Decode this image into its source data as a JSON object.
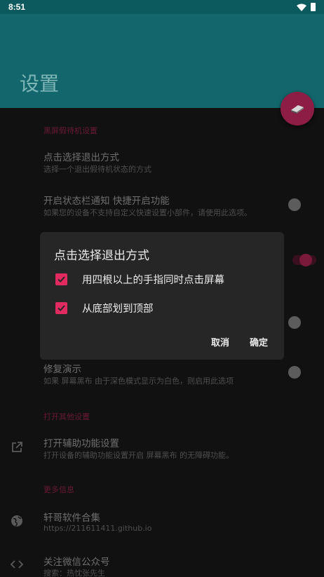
{
  "status": {
    "time": "8:51"
  },
  "appbar": {
    "title": "设置"
  },
  "sections": {
    "screen": "黑屏假待机设置",
    "other": "打开其他设置",
    "more": "更多信息"
  },
  "items": {
    "exit": {
      "title": "点击选择退出方式",
      "sub": "选择一个退出假待机状态的方式"
    },
    "notify": {
      "title": "开启状态栏通知 快捷开启功能",
      "sub": "如果您的设备不支持自定义快速设置小部件，请使用此选项。"
    },
    "fix": {
      "title": "修复演示",
      "sub": "如果 屏幕黑布 由于深色模式显示为白色，则启用此选项"
    },
    "access": {
      "title": "打开辅助功能设置",
      "sub": "打开设备的辅助功能设置开启 屏幕黑布 的无障碍功能。"
    },
    "apps": {
      "title": "轩哥软件合集",
      "sub": "https://211611411.github.io"
    },
    "wechat": {
      "title": "关注微信公众号",
      "sub": "搜索：热忱张先生"
    }
  },
  "switches": {
    "notify": false,
    "hidden1": true,
    "hidden2": false,
    "fix": false
  },
  "dialog": {
    "title": "点击选择退出方式",
    "options": [
      {
        "label": "用四根以上的手指同时点击屏幕",
        "checked": true
      },
      {
        "label": "从底部划到顶部",
        "checked": true
      }
    ],
    "cancel": "取消",
    "confirm": "确定"
  },
  "colors": {
    "accent": "#e02a60",
    "appbar": "#13676c",
    "statusbar": "#0d5a5e"
  }
}
